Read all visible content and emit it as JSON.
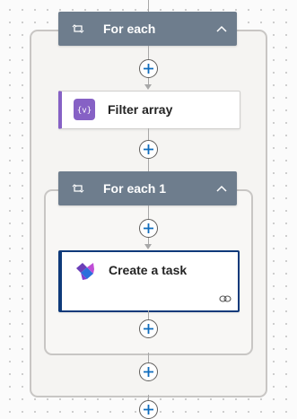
{
  "flow": {
    "outer_loop": {
      "title": "For each"
    },
    "filter_action": {
      "title": "Filter array",
      "icon": "filter-array-icon",
      "accent": "#8661c5"
    },
    "inner_loop": {
      "title": "For each 1"
    },
    "task_action": {
      "title": "Create a task",
      "icon": "planner-icon",
      "link_icon": "link-icon",
      "accent": "#0f3a7a"
    },
    "add_step_icon": "plus-icon",
    "colors": {
      "loop_header": "#6e7d8d",
      "connector": "#a8a8a8",
      "add_button": "#0f6cbd",
      "canvas": "#fbfbfb"
    }
  }
}
